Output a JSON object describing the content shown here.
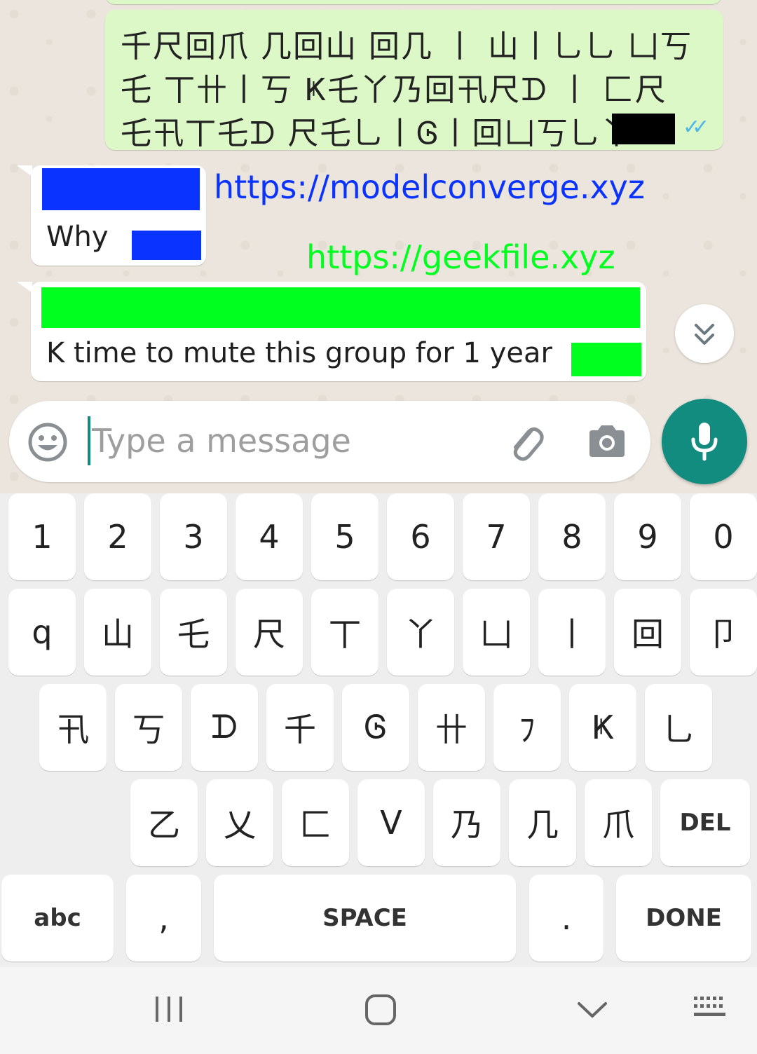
{
  "messages": {
    "outgoing": {
      "text": "千尺回爪 几回山 回几 丨 山丨乚乚 凵丂乇 丅卄丨丂 Ҝ乇丫乃回卂尺ᗪ 丨 匚尺乇卂丅乇ᗪ 尺乇乚丨Ꮆ丨回凵丂乚丫"
    },
    "incoming_1": {
      "text": "Why"
    },
    "incoming_2": {
      "text": "K time to mute this group for 1 year"
    }
  },
  "overlays": {
    "link_blue": "https://modelconverge.xyz",
    "link_green": "https://geekfile.xyz"
  },
  "input": {
    "placeholder": "Type a message"
  },
  "keyboard": {
    "row1": [
      "1",
      "2",
      "3",
      "4",
      "5",
      "6",
      "7",
      "8",
      "9",
      "0"
    ],
    "row2": [
      "q",
      "山",
      "乇",
      "尺",
      "丅",
      "丫",
      "凵",
      "丨",
      "回",
      "卩"
    ],
    "row3": [
      "卂",
      "丂",
      "ᗪ",
      "千",
      "Ꮆ",
      "卄",
      "ﾌ",
      "Ҝ",
      "乚"
    ],
    "row4": [
      "乙",
      "乂",
      "匚",
      "ᐯ",
      "乃",
      "几",
      "爪"
    ],
    "del": "DEL",
    "abc": "abc",
    "comma": ",",
    "space": "SPACE",
    "period": ".",
    "done": "DONE"
  },
  "colors": {
    "accent": "#128c7e",
    "outgoing_bubble": "#dcf8c6",
    "redact_blue": "#0a33ff",
    "redact_green": "#00ff1e"
  }
}
